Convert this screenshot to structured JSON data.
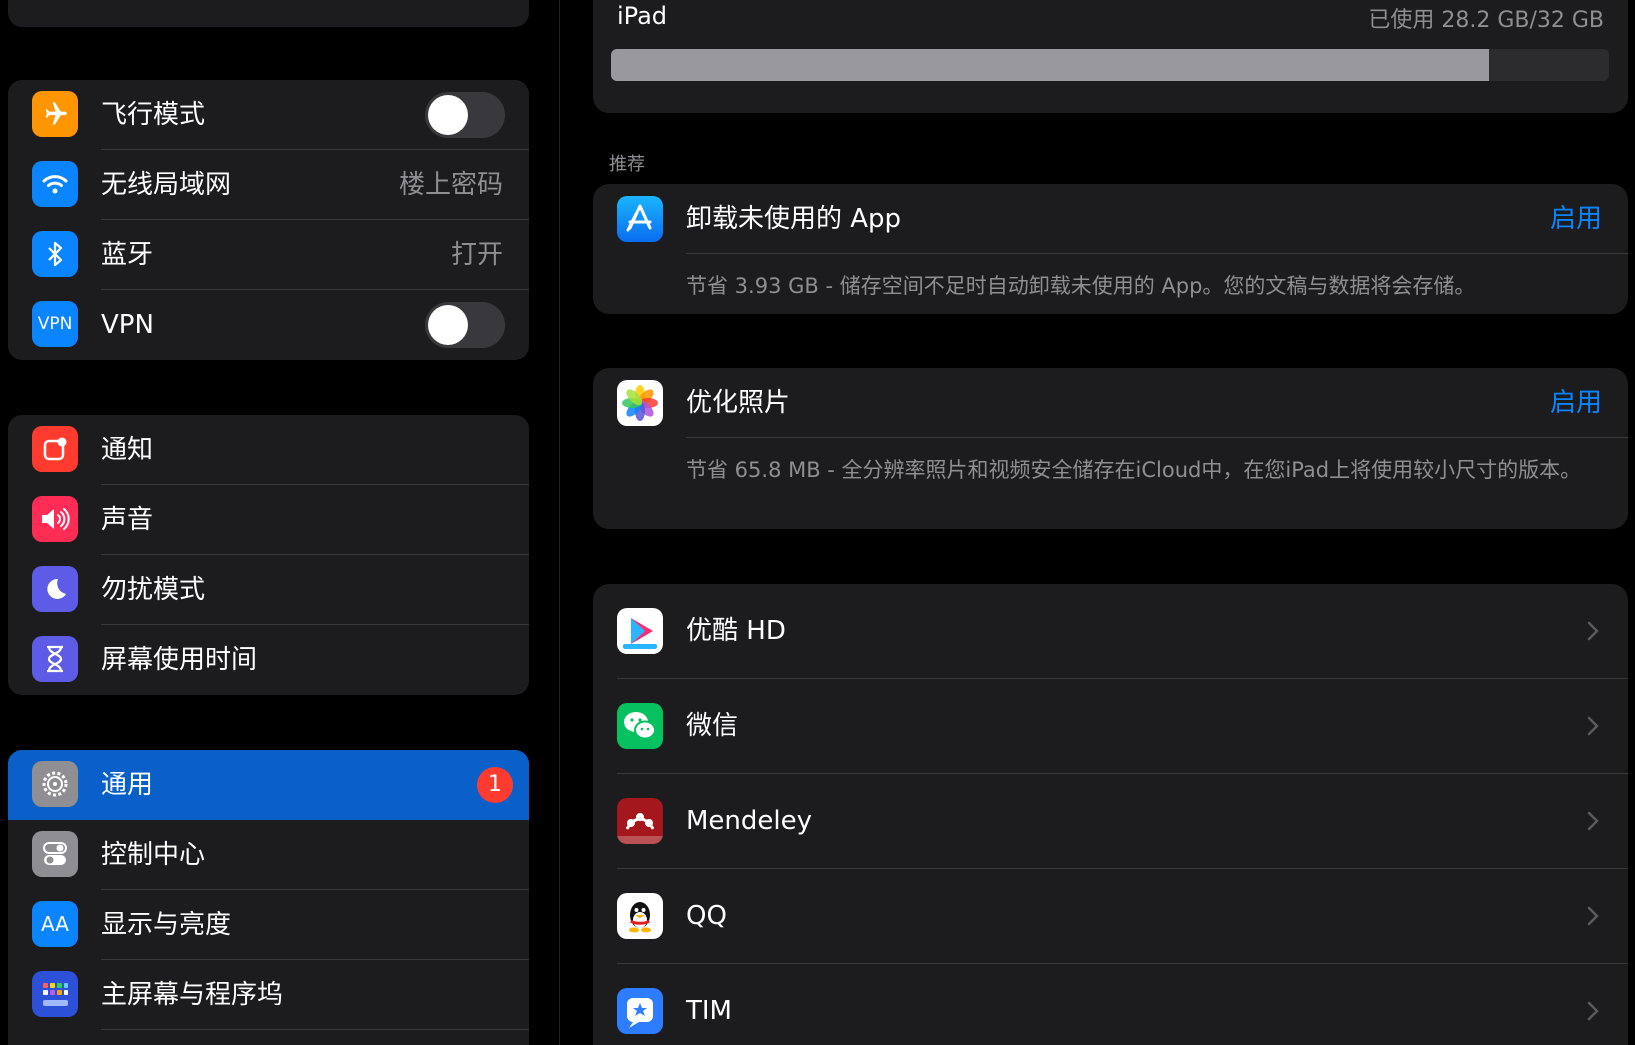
{
  "sidebar": {
    "group1": [
      {
        "label": "飞行模式",
        "icon": "airplane-icon",
        "color": "#ff9500",
        "toggle": false
      },
      {
        "label": "无线局域网",
        "icon": "wifi-icon",
        "color": "#0a84ff",
        "value": "楼上密码"
      },
      {
        "label": "蓝牙",
        "icon": "bluetooth-icon",
        "color": "#0a84ff",
        "value": "打开"
      },
      {
        "label": "VPN",
        "icon": "vpn-icon",
        "icon_text": "VPN",
        "color": "#0a84ff",
        "toggle": false
      }
    ],
    "group2": [
      {
        "label": "通知",
        "icon": "notifications-icon",
        "color": "#ff3b30"
      },
      {
        "label": "声音",
        "icon": "speaker-icon",
        "color": "#ff2d55"
      },
      {
        "label": "勿扰模式",
        "icon": "moon-icon",
        "color": "#5e5ce6"
      },
      {
        "label": "屏幕使用时间",
        "icon": "hourglass-icon",
        "color": "#5e5ce6"
      }
    ],
    "group3": [
      {
        "label": "通用",
        "icon": "gear-icon",
        "color": "#8e8e93",
        "badge": "1",
        "selected": true
      },
      {
        "label": "控制中心",
        "icon": "control-center-icon",
        "color": "#8e8e93"
      },
      {
        "label": "显示与亮度",
        "icon": "display-icon",
        "icon_text": "AA",
        "color": "#0a84ff"
      },
      {
        "label": "主屏幕与程序坞",
        "icon": "home-screen-icon",
        "color": "#0a84ff"
      }
    ]
  },
  "storage": {
    "device": "iPad",
    "used_text": "已使用 28.2 GB/32 GB",
    "used_fraction": 0.88
  },
  "recommendations": {
    "header": "推荐",
    "items": [
      {
        "title": "卸载未使用的 App",
        "action": "启用",
        "description": "节省 3.93 GB - 储存空间不足时自动卸载未使用的 App。您的文稿与数据将会存储。",
        "icon": "app-store-icon"
      },
      {
        "title": "优化照片",
        "action": "启用",
        "description": "节省 65.8 MB - 全分辨率照片和视频安全储存在iCloud中，在您iPad上将使用较小尺寸的版本。",
        "icon": "photos-icon"
      }
    ]
  },
  "apps": [
    {
      "name": "优酷 HD",
      "icon": "youku-icon"
    },
    {
      "name": "微信",
      "icon": "wechat-icon"
    },
    {
      "name": "Mendeley",
      "icon": "mendeley-icon"
    },
    {
      "name": "QQ",
      "icon": "qq-icon"
    },
    {
      "name": "TIM",
      "icon": "tim-icon"
    }
  ]
}
